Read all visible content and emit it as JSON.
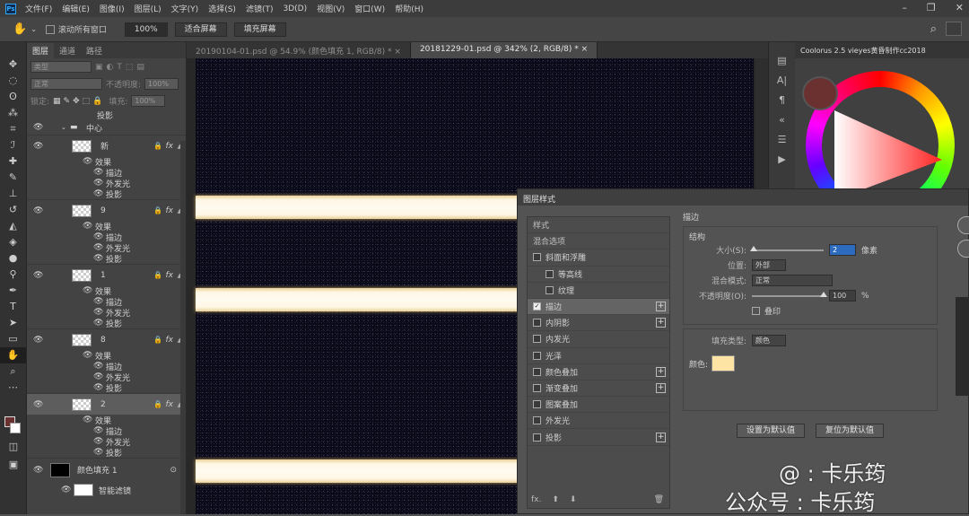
{
  "menubar": {
    "app_icon": "Ps",
    "items": [
      "文件(F)",
      "编辑(E)",
      "图像(I)",
      "图层(L)",
      "文字(Y)",
      "选择(S)",
      "滤镜(T)",
      "3D(D)",
      "视图(V)",
      "窗口(W)",
      "帮助(H)"
    ]
  },
  "options": {
    "scroll_all": "滚动所有窗口",
    "zoom": "100%",
    "fit_screen": "适合屏幕",
    "fill_screen": "填充屏幕"
  },
  "layers_panel": {
    "tabs": [
      "图层",
      "通道",
      "路径"
    ],
    "kind_placeholder": "类型",
    "blend_mode": "正常",
    "opacity_label": "不透明度:",
    "opacity_value": "100%",
    "lock_label": "锁定:",
    "fill_label": "填充:",
    "fill_value": "100%",
    "top_item": "投影",
    "group_name": "中心",
    "layers": [
      {
        "name": "新",
        "effects_label": "效果",
        "effects": [
          "描边",
          "外发光",
          "投影"
        ]
      },
      {
        "name": "9",
        "effects_label": "效果",
        "effects": [
          "描边",
          "外发光",
          "投影"
        ]
      },
      {
        "name": "1",
        "effects_label": "效果",
        "effects": [
          "描边",
          "外发光",
          "投影"
        ]
      },
      {
        "name": "8",
        "effects_label": "效果",
        "effects": [
          "描边",
          "外发光",
          "投影"
        ]
      },
      {
        "name": "2",
        "effects_label": "效果",
        "effects": [
          "描边",
          "外发光",
          "投影"
        ]
      }
    ],
    "fill_layer": "颜色填充 1",
    "smart_filter": "智能滤镜"
  },
  "documents": {
    "tabs": [
      "20190104-01.psd @ 54.9% (颜色填充 1, RGB/8) *",
      "20181229-01.psd @ 342% (2, RGB/8) *"
    ],
    "close_glyph": "×"
  },
  "coolorus": {
    "title": "Coolorus 2.5 vieyes黄昏制作cc2018",
    "current_color": "#6b3030"
  },
  "layer_style_dialog": {
    "title": "图层样式",
    "list": [
      {
        "label": "样式",
        "type": "header"
      },
      {
        "label": "混合选项",
        "type": "header"
      },
      {
        "label": "斜面和浮雕",
        "checked": false
      },
      {
        "label": "等高线",
        "checked": false,
        "indent": true
      },
      {
        "label": "纹理",
        "checked": false,
        "indent": true
      },
      {
        "label": "描边",
        "checked": true,
        "plus": true,
        "selected": true
      },
      {
        "label": "内阴影",
        "checked": false,
        "plus": true
      },
      {
        "label": "内发光",
        "checked": false
      },
      {
        "label": "光泽",
        "checked": false
      },
      {
        "label": "颜色叠加",
        "checked": false,
        "plus": true
      },
      {
        "label": "渐变叠加",
        "checked": false,
        "plus": true
      },
      {
        "label": "图案叠加",
        "checked": false
      },
      {
        "label": "外发光",
        "checked": false
      },
      {
        "label": "投影",
        "checked": false,
        "plus": true
      }
    ],
    "footer": [
      "fx.",
      "⬆",
      "⬇",
      "🗑"
    ],
    "stroke": {
      "section_title": "描边",
      "structure_title": "结构",
      "size_label": "大小(S):",
      "size_value": "2",
      "size_unit": "像素",
      "size_level": 0.02,
      "position_label": "位置:",
      "position_value": "外部",
      "blend_label": "混合模式:",
      "blend_value": "正常",
      "opacity_label": "不透明度(O):",
      "opacity_value": "100",
      "opacity_unit": "%",
      "opacity_level": 1.0,
      "overprint_label": "叠印",
      "fill_type_label": "填充类型:",
      "fill_type_value": "颜色",
      "color_label": "颜色:",
      "stroke_color": "#fde4a5",
      "make_default": "设置为默认值",
      "reset_default": "复位为默认值"
    }
  },
  "watermark": {
    "line1": "@ : 卡乐筠",
    "line2": "公众号 : 卡乐筠"
  }
}
